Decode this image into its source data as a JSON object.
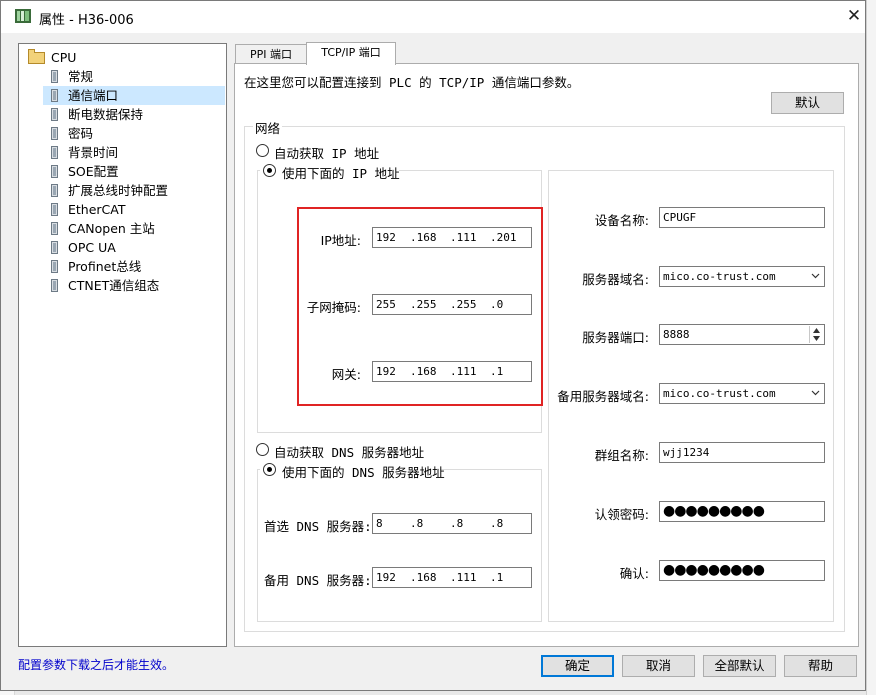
{
  "window": {
    "title": "属性 - H36-006",
    "close_label": "✕"
  },
  "tree": {
    "root": "CPU",
    "items": [
      "常规",
      "通信端口",
      "断电数据保持",
      "密码",
      "背景时间",
      "SOE配置",
      "扩展总线时钟配置",
      "EtherCAT",
      "CANopen 主站",
      "OPC UA",
      "Profinet总线",
      "CTNET通信组态"
    ],
    "selected": "通信端口"
  },
  "footnote": "配置参数下载之后才能生效。",
  "tabs": [
    {
      "label": "PPI 端口"
    },
    {
      "label": "TCP/IP 端口",
      "active": true
    }
  ],
  "description": "在这里您可以配置连接到 PLC 的 TCP/IP 通信端口参数。",
  "default_button": "默认",
  "network": {
    "legend": "网络",
    "auto_ip": "自动获取 IP 地址",
    "use_ip": "使用下面的 IP 地址",
    "ip_label": "IP地址:",
    "ip": [
      "192",
      ".168",
      ".111",
      ".201"
    ],
    "mask_label": "子网掩码:",
    "mask": [
      "255",
      ".255",
      ".255",
      ".0"
    ],
    "gateway_label": "网关:",
    "gateway": [
      "192",
      ".168",
      ".111",
      ".1"
    ],
    "auto_dns": "自动获取 DNS 服务器地址",
    "use_dns": "使用下面的 DNS 服务器地址",
    "dns1_label": "首选 DNS 服务器:",
    "dns1": [
      "8",
      ".8",
      ".8",
      ".8"
    ],
    "dns2_label": "备用 DNS 服务器:",
    "dns2": [
      "192",
      ".168",
      ".111",
      ".1"
    ]
  },
  "device": {
    "name_label": "设备名称:",
    "name": "CPUGF",
    "domain_label": "服务器域名:",
    "domain": "mico.co-trust.com",
    "port_label": "服务器端口:",
    "port": "8888",
    "backup_domain_label": "备用服务器域名:",
    "backup_domain": "mico.co-trust.com",
    "group_label": "群组名称:",
    "group": "wjj1234",
    "auth_label": "认领密码:",
    "auth_mask": "●●●●●●●●●",
    "confirm_label": "确认:",
    "confirm_mask": "●●●●●●●●●"
  },
  "buttons": {
    "ok": "确定",
    "cancel": "取消",
    "all_default": "全部默认",
    "help": "帮助"
  },
  "colors": {
    "selection": "#cce8ff",
    "highlight_box": "#e02424",
    "footnote": "#0000cc",
    "default_border": "#0078d7"
  }
}
